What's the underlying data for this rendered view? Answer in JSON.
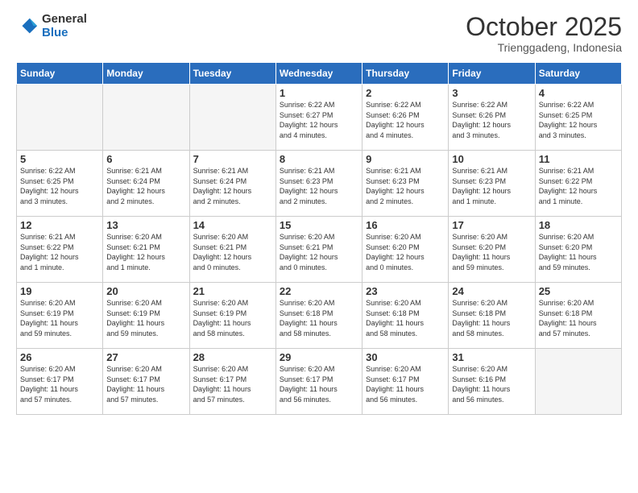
{
  "logo": {
    "general": "General",
    "blue": "Blue"
  },
  "header": {
    "month": "October 2025",
    "location": "Trienggadeng, Indonesia"
  },
  "weekdays": [
    "Sunday",
    "Monday",
    "Tuesday",
    "Wednesday",
    "Thursday",
    "Friday",
    "Saturday"
  ],
  "weeks": [
    [
      {
        "day": "",
        "info": ""
      },
      {
        "day": "",
        "info": ""
      },
      {
        "day": "",
        "info": ""
      },
      {
        "day": "1",
        "info": "Sunrise: 6:22 AM\nSunset: 6:27 PM\nDaylight: 12 hours\nand 4 minutes."
      },
      {
        "day": "2",
        "info": "Sunrise: 6:22 AM\nSunset: 6:26 PM\nDaylight: 12 hours\nand 4 minutes."
      },
      {
        "day": "3",
        "info": "Sunrise: 6:22 AM\nSunset: 6:26 PM\nDaylight: 12 hours\nand 3 minutes."
      },
      {
        "day": "4",
        "info": "Sunrise: 6:22 AM\nSunset: 6:25 PM\nDaylight: 12 hours\nand 3 minutes."
      }
    ],
    [
      {
        "day": "5",
        "info": "Sunrise: 6:22 AM\nSunset: 6:25 PM\nDaylight: 12 hours\nand 3 minutes."
      },
      {
        "day": "6",
        "info": "Sunrise: 6:21 AM\nSunset: 6:24 PM\nDaylight: 12 hours\nand 2 minutes."
      },
      {
        "day": "7",
        "info": "Sunrise: 6:21 AM\nSunset: 6:24 PM\nDaylight: 12 hours\nand 2 minutes."
      },
      {
        "day": "8",
        "info": "Sunrise: 6:21 AM\nSunset: 6:23 PM\nDaylight: 12 hours\nand 2 minutes."
      },
      {
        "day": "9",
        "info": "Sunrise: 6:21 AM\nSunset: 6:23 PM\nDaylight: 12 hours\nand 2 minutes."
      },
      {
        "day": "10",
        "info": "Sunrise: 6:21 AM\nSunset: 6:23 PM\nDaylight: 12 hours\nand 1 minute."
      },
      {
        "day": "11",
        "info": "Sunrise: 6:21 AM\nSunset: 6:22 PM\nDaylight: 12 hours\nand 1 minute."
      }
    ],
    [
      {
        "day": "12",
        "info": "Sunrise: 6:21 AM\nSunset: 6:22 PM\nDaylight: 12 hours\nand 1 minute."
      },
      {
        "day": "13",
        "info": "Sunrise: 6:20 AM\nSunset: 6:21 PM\nDaylight: 12 hours\nand 1 minute."
      },
      {
        "day": "14",
        "info": "Sunrise: 6:20 AM\nSunset: 6:21 PM\nDaylight: 12 hours\nand 0 minutes."
      },
      {
        "day": "15",
        "info": "Sunrise: 6:20 AM\nSunset: 6:21 PM\nDaylight: 12 hours\nand 0 minutes."
      },
      {
        "day": "16",
        "info": "Sunrise: 6:20 AM\nSunset: 6:20 PM\nDaylight: 12 hours\nand 0 minutes."
      },
      {
        "day": "17",
        "info": "Sunrise: 6:20 AM\nSunset: 6:20 PM\nDaylight: 11 hours\nand 59 minutes."
      },
      {
        "day": "18",
        "info": "Sunrise: 6:20 AM\nSunset: 6:20 PM\nDaylight: 11 hours\nand 59 minutes."
      }
    ],
    [
      {
        "day": "19",
        "info": "Sunrise: 6:20 AM\nSunset: 6:19 PM\nDaylight: 11 hours\nand 59 minutes."
      },
      {
        "day": "20",
        "info": "Sunrise: 6:20 AM\nSunset: 6:19 PM\nDaylight: 11 hours\nand 59 minutes."
      },
      {
        "day": "21",
        "info": "Sunrise: 6:20 AM\nSunset: 6:19 PM\nDaylight: 11 hours\nand 58 minutes."
      },
      {
        "day": "22",
        "info": "Sunrise: 6:20 AM\nSunset: 6:18 PM\nDaylight: 11 hours\nand 58 minutes."
      },
      {
        "day": "23",
        "info": "Sunrise: 6:20 AM\nSunset: 6:18 PM\nDaylight: 11 hours\nand 58 minutes."
      },
      {
        "day": "24",
        "info": "Sunrise: 6:20 AM\nSunset: 6:18 PM\nDaylight: 11 hours\nand 58 minutes."
      },
      {
        "day": "25",
        "info": "Sunrise: 6:20 AM\nSunset: 6:18 PM\nDaylight: 11 hours\nand 57 minutes."
      }
    ],
    [
      {
        "day": "26",
        "info": "Sunrise: 6:20 AM\nSunset: 6:17 PM\nDaylight: 11 hours\nand 57 minutes."
      },
      {
        "day": "27",
        "info": "Sunrise: 6:20 AM\nSunset: 6:17 PM\nDaylight: 11 hours\nand 57 minutes."
      },
      {
        "day": "28",
        "info": "Sunrise: 6:20 AM\nSunset: 6:17 PM\nDaylight: 11 hours\nand 57 minutes."
      },
      {
        "day": "29",
        "info": "Sunrise: 6:20 AM\nSunset: 6:17 PM\nDaylight: 11 hours\nand 56 minutes."
      },
      {
        "day": "30",
        "info": "Sunrise: 6:20 AM\nSunset: 6:17 PM\nDaylight: 11 hours\nand 56 minutes."
      },
      {
        "day": "31",
        "info": "Sunrise: 6:20 AM\nSunset: 6:16 PM\nDaylight: 11 hours\nand 56 minutes."
      },
      {
        "day": "",
        "info": ""
      }
    ]
  ]
}
